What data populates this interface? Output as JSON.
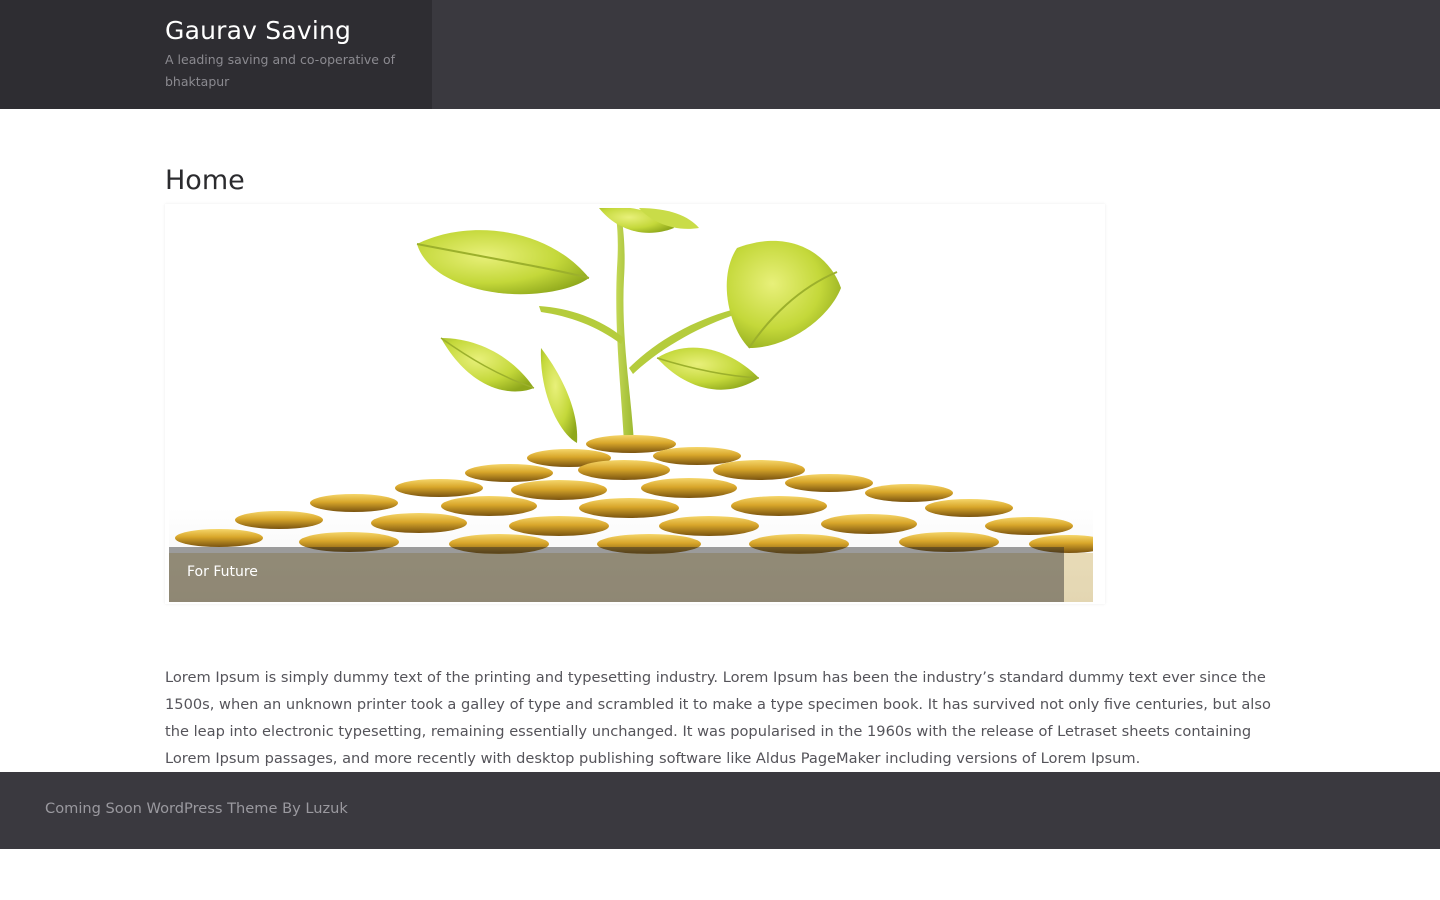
{
  "header": {
    "site_title": "Gaurav Saving",
    "site_description": "A leading saving and co-operative of bhaktapur"
  },
  "main": {
    "page_title": "Home",
    "slider": {
      "slides": [
        {
          "caption": "For Future"
        }
      ]
    },
    "body_text": "Lorem Ipsum is simply dummy text of the printing and typesetting industry. Lorem Ipsum has been the industry’s standard dummy text ever since the 1500s, when an unknown printer took a galley of type and scrambled it to make a type specimen book. It has survived not only five centuries, but also the leap into electronic typesetting, remaining essentially unchanged. It was popularised in the 1960s with the release of Letraset sheets containing Lorem Ipsum passages, and more recently with desktop publishing software like Aldus PageMaker including versions of Lorem Ipsum."
  },
  "footer": {
    "credit": "Coming Soon WordPress Theme By Luzuk"
  },
  "colors": {
    "header_bg": "#3a393f",
    "branding_bg": "#2e2d32",
    "footer_bg": "#3a393f",
    "text": "#55545a"
  }
}
